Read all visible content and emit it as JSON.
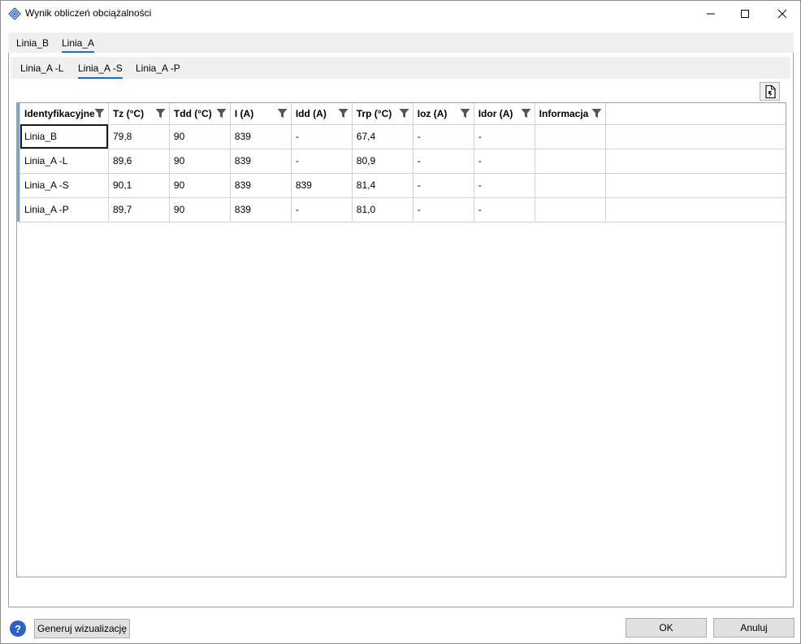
{
  "window": {
    "title": "Wynik obliczeń obciążalności",
    "icon": "diamond-app-icon"
  },
  "outer_tabs": [
    {
      "label": "Linia_B",
      "active": false
    },
    {
      "label": "Linia_A",
      "active": true
    }
  ],
  "inner_tabs": [
    {
      "label": "Linia_A -L",
      "active": false
    },
    {
      "label": "Linia_A -S",
      "active": true
    },
    {
      "label": "Linia_A -P",
      "active": false
    }
  ],
  "toolbar": {
    "export_icon": "export-document-icon"
  },
  "grid": {
    "columns": [
      "Identyfikacyjne",
      "Tz (°C)",
      "Tdd (°C)",
      "I (A)",
      "Idd (A)",
      "Trp (°C)",
      "Ioz (A)",
      "Idor (A)",
      "Informacja"
    ],
    "rows": [
      [
        "Linia_B",
        "79,8",
        "90",
        "839",
        "-",
        "67,4",
        "-",
        "-",
        ""
      ],
      [
        "Linia_A -L",
        "89,6",
        "90",
        "839",
        "-",
        "80,9",
        "-",
        "-",
        ""
      ],
      [
        "Linia_A -S",
        "90,1",
        "90",
        "839",
        "839",
        "81,4",
        "-",
        "-",
        ""
      ],
      [
        "Linia_A -P",
        "89,7",
        "90",
        "839",
        "-",
        "81,0",
        "-",
        "-",
        ""
      ]
    ]
  },
  "footer": {
    "help_label": "?",
    "generate_label": "Generuj wizualizację",
    "ok_label": "OK",
    "cancel_label": "Anuluj"
  },
  "colors": {
    "accent": "#1f6fbf",
    "row_marker": "#6fa8dc",
    "help": "#2b63c4"
  }
}
